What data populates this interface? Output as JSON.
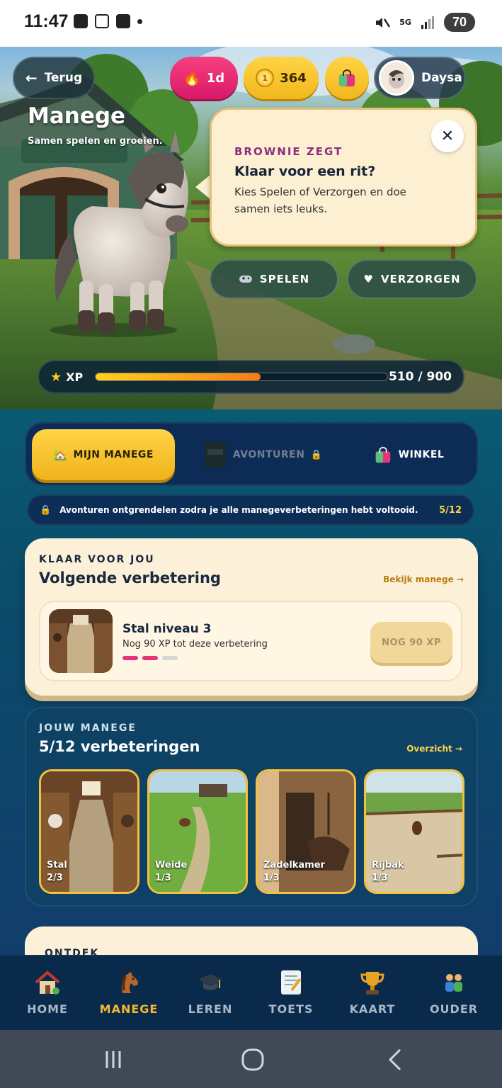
{
  "status_bar": {
    "time": "11:47",
    "network": "5G",
    "battery": "70"
  },
  "header": {
    "back_label": "Terug",
    "streak_value": "1d",
    "coins_value": "364",
    "profile_name": "Daysa"
  },
  "page": {
    "title": "Manege",
    "subtitle": "Samen spelen en groeien."
  },
  "bubble": {
    "label": "BROWNIE ZEGT",
    "title": "Klaar voor een rit?",
    "text": "Kies Spelen of Verzorgen en doe samen iets leuks.",
    "close_glyph": "✕"
  },
  "actions": {
    "play_label": "SPELEN",
    "care_label": "VERZORGEN"
  },
  "xp": {
    "label": "XP",
    "value_text": "510 / 900",
    "current": 510,
    "max": 900
  },
  "tabs": [
    {
      "label": "MIJN MANEGE",
      "active": true
    },
    {
      "label": "AVONTUREN",
      "locked": true
    },
    {
      "label": "WINKEL"
    }
  ],
  "info_banner": {
    "text": "Avonturen ontgrendelen zodra je alle manegeverbeteringen hebt voltooid.",
    "count": "5/12"
  },
  "next_upgrade": {
    "eyebrow": "KLAAR VOOR JOU",
    "title": "Volgende verbetering",
    "link": "Bekijk manege →",
    "item_title": "Stal niveau 3",
    "item_subtitle": "Nog 90 XP tot deze verbetering",
    "progress_filled": 2,
    "progress_total": 3,
    "button_label": "NOG 90 XP"
  },
  "my_stable": {
    "eyebrow": "JOUW MANEGE",
    "title": "5/12 verbeteringen",
    "link": "Overzicht →",
    "tiles": [
      {
        "name": "Stal",
        "value": "2/3"
      },
      {
        "name": "Weide",
        "value": "1/3"
      },
      {
        "name": "Zadelkamer",
        "value": "1/3"
      },
      {
        "name": "Rijbak",
        "value": "1/3"
      }
    ]
  },
  "discover": {
    "eyebrow": "ONTDEK"
  },
  "bottom_nav": [
    {
      "label": "HOME",
      "icon": "house-icon"
    },
    {
      "label": "MANEGE",
      "icon": "horse-icon",
      "active": true
    },
    {
      "label": "LEREN",
      "icon": "graduation-cap-icon"
    },
    {
      "label": "TOETS",
      "icon": "test-paper-icon"
    },
    {
      "label": "KAART",
      "icon": "trophy-icon"
    },
    {
      "label": "OUDER",
      "icon": "parents-icon"
    }
  ],
  "colors": {
    "accent": "#f5b82e",
    "pink": "#e7337c",
    "navy": "#0a2a4c"
  }
}
